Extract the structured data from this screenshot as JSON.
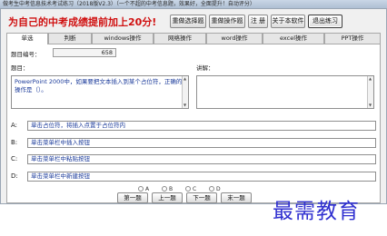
{
  "window": {
    "title": "做考生中考信息技术考试练习（2018版V2.3）（一个不超的中考信息题，效果好，全面提升！自动评分）"
  },
  "headline": "为自己的中考成绩提前加上20分!",
  "top_buttons": [
    {
      "label": "重做选择题"
    },
    {
      "label": "重做操作题"
    },
    {
      "label": "注  册"
    },
    {
      "label": "关于本软件"
    },
    {
      "label": "退出练习"
    }
  ],
  "tabs": [
    {
      "label": "单选"
    },
    {
      "label": "判断"
    },
    {
      "label": "windows操作"
    },
    {
      "label": "网络操作"
    },
    {
      "label": "word操作"
    },
    {
      "label": "excel操作"
    },
    {
      "label": "PPT操作"
    }
  ],
  "question": {
    "number_label": "题目编号：",
    "number_value": "658",
    "title_label": "题目：",
    "explain_label": "讲解：",
    "text": "PowerPoint 2000中，如果要把文本插入到某个占位符，正确的操作是（）。",
    "explain_text": ""
  },
  "options": [
    {
      "letter": "A:",
      "text": "单击占位符，将插入点置于占位符内"
    },
    {
      "letter": "B:",
      "text": "单击菜单栏中插入按钮"
    },
    {
      "letter": "C:",
      "text": "单击菜单栏中粘贴按钮"
    },
    {
      "letter": "D:",
      "text": "单击菜单栏中新建按钮"
    }
  ],
  "answer_radios": [
    {
      "label": "A"
    },
    {
      "label": "B"
    },
    {
      "label": "C"
    },
    {
      "label": "D"
    }
  ],
  "nav_buttons": [
    {
      "label": "第一题"
    },
    {
      "label": "上一题"
    },
    {
      "label": "下一题"
    },
    {
      "label": "末一题"
    }
  ],
  "watermark": "最需教育",
  "colors": {
    "headline": "#d01010",
    "option_text": "#1a3a9a",
    "watermark": "#2f2fd0"
  }
}
